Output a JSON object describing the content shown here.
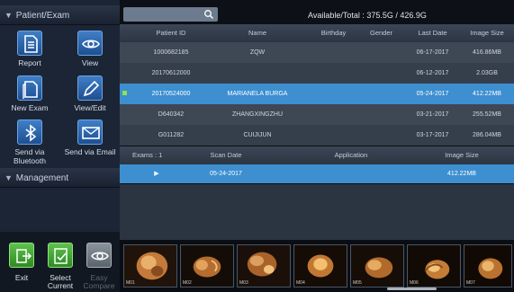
{
  "panel": {
    "patient_exam_title": "Patient/Exam",
    "management_title": "Management",
    "tools": [
      {
        "label": "Report"
      },
      {
        "label": "View"
      },
      {
        "label": "New Exam"
      },
      {
        "label": "View/Edit"
      },
      {
        "label_line1": "Send via",
        "label_line2": "Bluetooth"
      },
      {
        "label": "Send via Email"
      }
    ],
    "bottom_tools": [
      {
        "label": "Exit"
      },
      {
        "label_line1": "Select",
        "label_line2": "Current"
      },
      {
        "label_line1": "Easy",
        "label_line2": "Compare"
      }
    ]
  },
  "header": {
    "available_total": "Available/Total : 375.5G / 426.9G"
  },
  "patient_table": {
    "columns": [
      "Patient ID",
      "Name",
      "Birthday",
      "Gender",
      "Last Date",
      "Image Size"
    ],
    "rows": [
      {
        "patient_id": "1000682185",
        "name": "ZQW",
        "birthday": "",
        "gender": "",
        "last_date": "06-17-2017",
        "image_size": "416.86MB",
        "selected": false
      },
      {
        "patient_id": "20170612000",
        "name": "",
        "birthday": "",
        "gender": "",
        "last_date": "06-12-2017",
        "image_size": "2.03GB",
        "selected": false
      },
      {
        "patient_id": "20170524000",
        "name": "MARIANELA BURGA",
        "birthday": "",
        "gender": "",
        "last_date": "05-24-2017",
        "image_size": "412.22MB",
        "selected": true
      },
      {
        "patient_id": "D640342",
        "name": "ZHANGXINGZHU",
        "birthday": "",
        "gender": "",
        "last_date": "03-21-2017",
        "image_size": "255.52MB",
        "selected": false
      },
      {
        "patient_id": "G011282",
        "name": "CUIJIJUN",
        "birthday": "",
        "gender": "",
        "last_date": "03-17-2017",
        "image_size": "286.04MB",
        "selected": false
      }
    ]
  },
  "exam_table": {
    "columns": [
      "Exams : 1",
      "Scan Date",
      "Application",
      "Image Size"
    ],
    "rows": [
      {
        "scan_date": "05-24-2017",
        "application": "",
        "image_size": "412.22MB"
      }
    ]
  },
  "thumbnails": [
    {
      "tag": "M01"
    },
    {
      "tag": "M02"
    },
    {
      "tag": "M03"
    },
    {
      "tag": "M04"
    },
    {
      "tag": "M05"
    },
    {
      "tag": "M06"
    },
    {
      "tag": "M07"
    }
  ],
  "colors": {
    "selection_blue": "#3d8fd0",
    "panel_bg": "#1b2536",
    "exit_green": "#47ad3a"
  }
}
